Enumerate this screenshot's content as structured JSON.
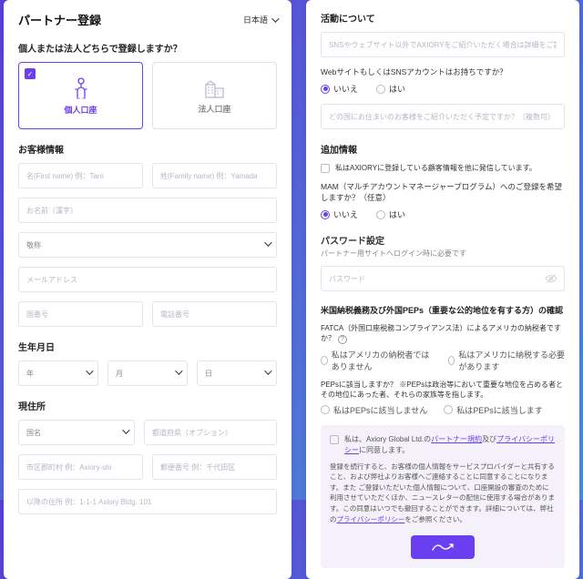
{
  "header": {
    "title": "パートナー登録",
    "language": "日本語"
  },
  "account_type": {
    "question": "個人または法人どちらで登録しますか？",
    "individual": "個人口座",
    "corporate": "法人口座"
  },
  "customer": {
    "heading": "お客様情報",
    "first_name_ph": "名(First name) 例：Taro",
    "last_name_ph": "姓(Family name) 例：Yamada",
    "name_kanji_ph": "お名前（漢字）",
    "title_ph": "敬称",
    "email_ph": "メールアドレス",
    "country_code_ph": "国番号",
    "phone_ph": "電話番号"
  },
  "dob": {
    "heading": "生年月日",
    "year_ph": "年",
    "month_ph": "月",
    "day_ph": "日"
  },
  "address": {
    "heading": "現住所",
    "country_ph": "国名",
    "prefecture_ph": "都道府県（オプション）",
    "city_ph": "市区郡町村 例：Axiory-shi",
    "postal_ph": "郵便番号 例：千代田区",
    "rest_ph": "以降の住所 例：1-1-1 Axiory Bldg. 101"
  },
  "activity": {
    "heading": "活動について",
    "channel_ph": "SNSやウェブサイト以外でAXIORYをご紹介いただく場合は詳細をご記入ください。",
    "has_site_q": "WebサイトもしくはSNSアカウントはお持ちですか？",
    "no": "いいえ",
    "yes": "はい",
    "region_ph": "どの国にお住まいのお客様をご紹介いただく予定ですか？（複数可）"
  },
  "additional": {
    "heading": "追加情報",
    "consent": "私はAXIORYに登録している顧客情報を他に発信しています。",
    "mam_q": "MAM（マルチアカウントマネージャープログラム）へのご登録を希望しますか？（任意）",
    "no": "いいえ",
    "yes": "はい"
  },
  "password": {
    "heading": "パスワード設定",
    "note": "パートナー用サイトへログイン時に必要です",
    "ph": "パスワード"
  },
  "compliance": {
    "heading": "米国納税義務及び外国PEPs（重要な公的地位を有する方）の確認",
    "fatca_q": "FATCA（外国口座税務コンプライアンス法）によるアメリカの納税者ですか？",
    "fatca_opt1": "私はアメリカの納税者ではありません",
    "fatca_opt2": "私はアメリカに納税する必要があります",
    "peps_q": "PEPsに該当しますか？ ※PEPsは政治等において重要な地位を占める者とその地位にあった者、それらの家族等を指します。",
    "peps_opt1": "私はPEPsに該当しません",
    "peps_opt2": "私はPEPsに該当します"
  },
  "policy": {
    "lead_pre": "私は、Axiory Global Ltd.の",
    "partner_terms": "パートナー規約",
    "and": "及び",
    "privacy": "プライバシーポリシー",
    "lead_post": "に同意します。",
    "body": "登録を続行すると、お客様の個人情報をサービスプロバイダーと共有すること、および弊社よりお客様へご連絡することに同意することになります。また ご登録いただいた個人情報について、口座開設の審査のために利用させていただくほか、ニュースレターの配信に使用する場合があります。この同意はいつでも撤回することができます。詳細については、弊社の",
    "body_link": "プライバシーポリシー",
    "body_tail": "をご参照ください。"
  }
}
